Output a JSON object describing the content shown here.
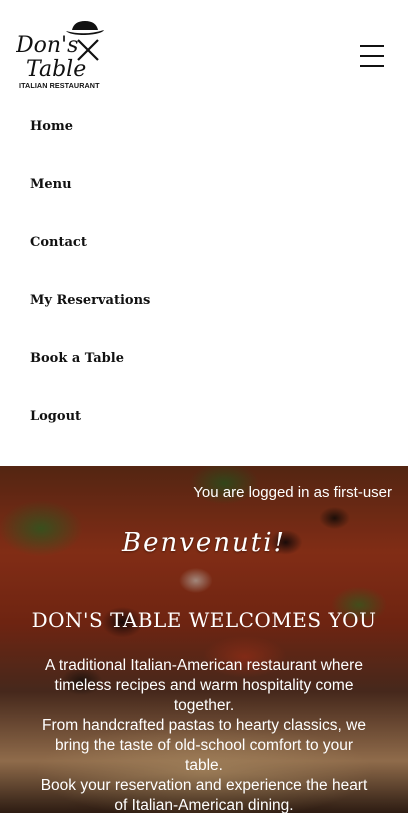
{
  "brand": {
    "logo_line1": "Don's",
    "logo_line2": "Table",
    "logo_sub": "ITALIAN RESTAURANT"
  },
  "header": {
    "menu_icon": "hamburger-icon"
  },
  "nav": {
    "items": [
      {
        "label": "Home"
      },
      {
        "label": "Menu"
      },
      {
        "label": "Contact"
      },
      {
        "label": "My Reservations"
      },
      {
        "label": "Book a Table"
      },
      {
        "label": "Logout"
      }
    ]
  },
  "hero": {
    "logged_in_text": "You are logged in as first-user",
    "greeting": "Benvenuti!",
    "title": "DON'S TABLE WELCOMES YOU",
    "paragraphs": [
      "A traditional Italian-American restaurant where timeless recipes and warm hospitality come together.",
      "From handcrafted pastas to hearty classics, we bring the taste of old-school comfort to your table.",
      "Book your reservation and experience the heart of Italian-American dining."
    ]
  }
}
